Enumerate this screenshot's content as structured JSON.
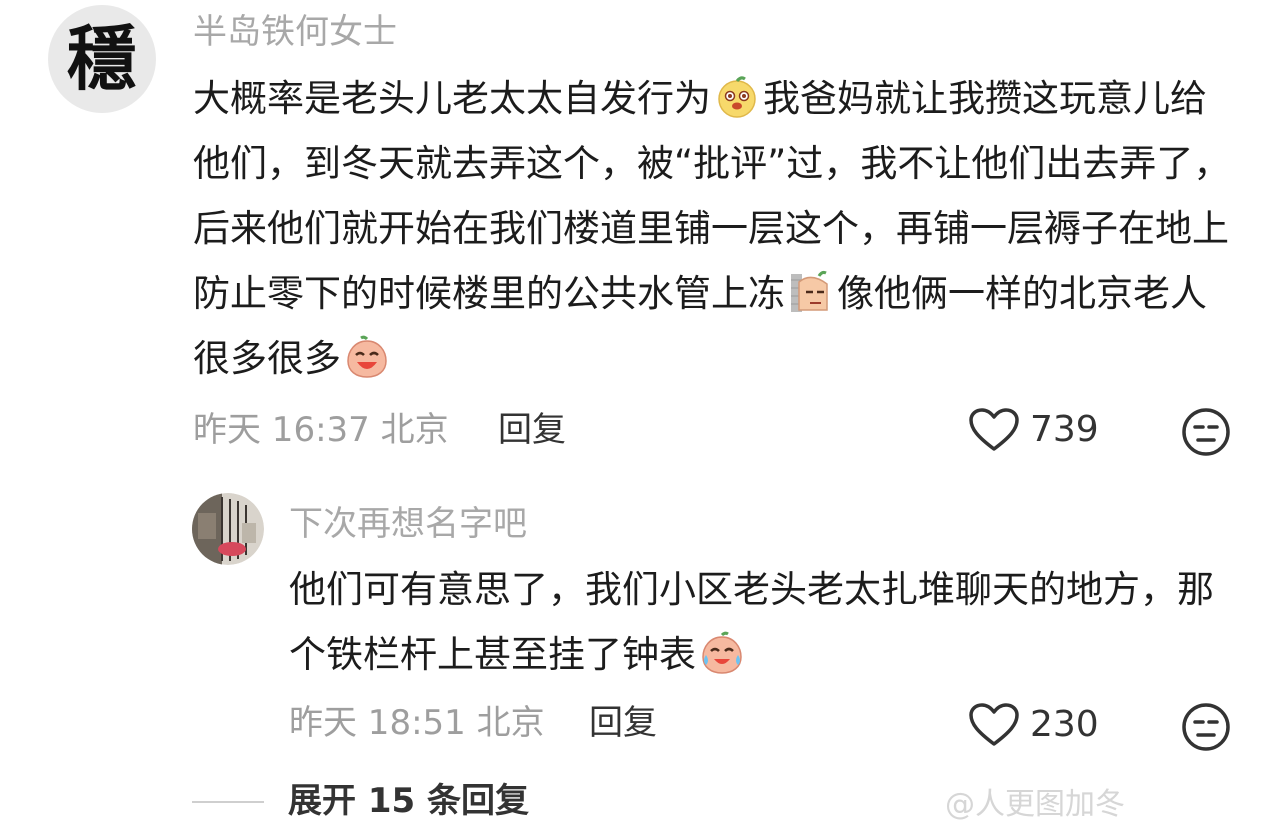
{
  "comments": [
    {
      "avatar_char": "穩",
      "username": "半岛铁何女士",
      "text_parts": [
        "大概率是老头儿老太太自发行为",
        "我爸妈就让我攒这玩意儿给他们，到冬天就去弄这个，被“批评”过，我不让他们出去弄了，后来他们就开始在我们楼道里铺一层这个，再铺一层褥子在地上防止零下的时候楼里的公共水管上冻",
        "像他俩一样的北京老人很多很多"
      ],
      "emojis": [
        "doge-face-emoji",
        "side-eye-emoji",
        "laughing-face-emoji"
      ],
      "time": "昨天 16:37 北京",
      "reply_label": "回复",
      "likes": "739"
    },
    {
      "username": "下次再想名字吧",
      "text_parts": [
        "他们可有意思了，我们小区老头老太扎堆聊天的地方，那个铁栏杆上甚至挂了钟表"
      ],
      "emojis": [
        "crying-laughing-emoji"
      ],
      "time": "昨天 18:51 北京",
      "reply_label": "回复",
      "likes": "230"
    }
  ],
  "expand_label": "展开 15 条回复",
  "watermark": "@人更图加冬"
}
